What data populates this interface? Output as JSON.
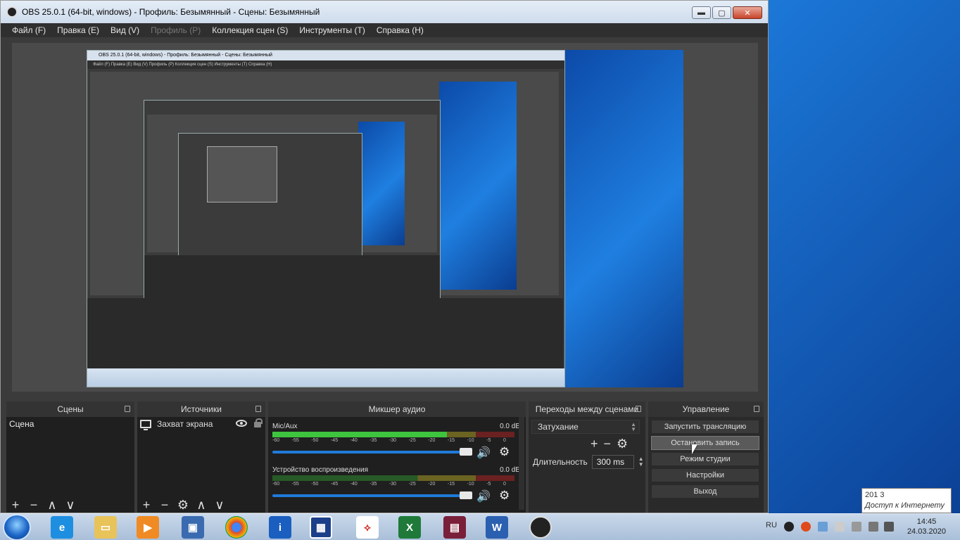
{
  "window": {
    "title": "OBS 25.0.1 (64-bit, windows) - Профиль: Безымянный - Сцены: Безымянный",
    "minimize": "▬",
    "maximize": "▢",
    "close": "✕"
  },
  "menu": {
    "file": "Файл (F)",
    "edit": "Правка (E)",
    "view": "Вид (V)",
    "profile": "Профиль (P)",
    "scene_collection": "Коллекция сцен (S)",
    "tools": "Инструменты (T)",
    "help": "Справка (H)"
  },
  "nested_preview": {
    "title": "OBS 25.0.1 (64-bit, windows) - Профиль: Безымянный - Сцены: Безымянный",
    "menu": "Файл (F)   Правка (E)   Вид (V)   Профиль (P)   Коллекция сцен (S)   Инструменты (T)   Справка (H)"
  },
  "scenes": {
    "header": "Сцены",
    "items": [
      "Сцена"
    ]
  },
  "sources": {
    "header": "Источники",
    "items": [
      "Захват экрана"
    ]
  },
  "tool_icons": {
    "add": "+",
    "remove": "−",
    "settings": "⚙",
    "up": "∧",
    "down": "∨"
  },
  "mixer": {
    "header": "Микшер аудио",
    "channels": [
      {
        "name": "Mic/Aux",
        "db": "0.0 dB",
        "level": 0.72
      },
      {
        "name": "Устройство воспроизведения",
        "db": "0.0 dB",
        "level": 0.0
      }
    ],
    "ticks": [
      "-60",
      "-55",
      "-50",
      "-45",
      "-40",
      "-35",
      "-30",
      "-25",
      "-20",
      "-15",
      "-10",
      "-5",
      "0"
    ]
  },
  "transitions": {
    "header": "Переходы между сценами",
    "selected": "Затухание",
    "duration_label": "Длительность",
    "duration_value": "300 ms"
  },
  "controls": {
    "header": "Управление",
    "start_stream": "Запустить трансляцию",
    "stop_record": "Остановить запись",
    "studio_mode": "Режим студии",
    "settings": "Настройки",
    "exit": "Выход"
  },
  "taskbar": {
    "lang": "RU",
    "time": "14:45",
    "date": "24.03.2020",
    "apps": [
      "ie-icon",
      "explorer-icon",
      "media-player-icon",
      "remote-desktop-icon",
      "chrome-icon",
      "info-icon",
      "calculator-icon",
      "pdf-icon",
      "excel-icon",
      "winrar-icon",
      "word-icon",
      "obs-icon"
    ]
  },
  "tooltip": {
    "line1": "201  3",
    "line2": "Доступ к Интернету"
  }
}
